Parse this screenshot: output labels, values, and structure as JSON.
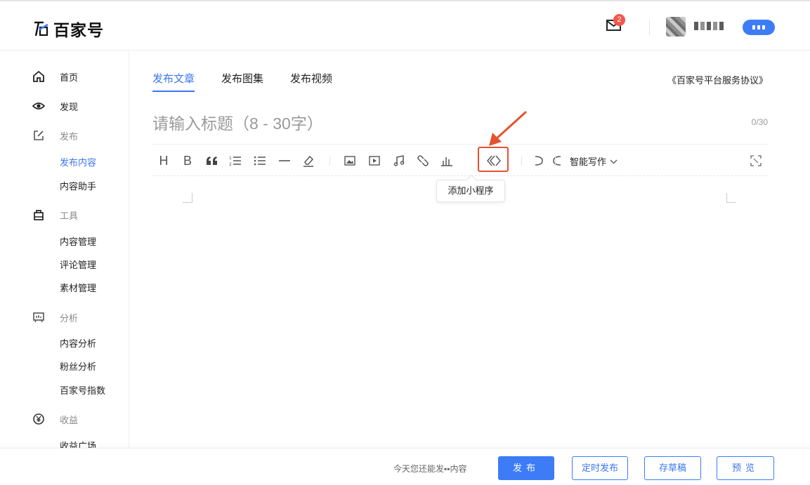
{
  "header": {
    "logo_text": "百家号",
    "mail_badge": "2"
  },
  "sidebar": {
    "items": [
      {
        "label": "首页",
        "kind": "top",
        "icon": "home-icon"
      },
      {
        "label": "发现",
        "kind": "top",
        "icon": "eye-icon"
      },
      {
        "label": "发布",
        "kind": "section",
        "icon": "edit-icon"
      },
      {
        "label": "发布内容",
        "kind": "sub-active"
      },
      {
        "label": "内容助手",
        "kind": "sub"
      },
      {
        "label": "工具",
        "kind": "section",
        "icon": "bag-icon"
      },
      {
        "label": "内容管理",
        "kind": "sub"
      },
      {
        "label": "评论管理",
        "kind": "sub"
      },
      {
        "label": "素材管理",
        "kind": "sub"
      },
      {
        "label": "分析",
        "kind": "section",
        "icon": "board-icon"
      },
      {
        "label": "内容分析",
        "kind": "sub"
      },
      {
        "label": "粉丝分析",
        "kind": "sub"
      },
      {
        "label": "百家号指数",
        "kind": "sub"
      },
      {
        "label": "收益",
        "kind": "section",
        "icon": "yuan-icon"
      },
      {
        "label": "收益广场",
        "kind": "sub"
      }
    ]
  },
  "tabs": [
    {
      "label": "发布文章",
      "active": true
    },
    {
      "label": "发布图集",
      "active": false
    },
    {
      "label": "发布视频",
      "active": false
    }
  ],
  "agreement_link": "《百家号平台服务协议》",
  "title_placeholder": "请输入标题（8 - 30字）",
  "title_counter": "0/30",
  "toolbar": {
    "smart_write_label": "智能写作",
    "tooltip": "添加小程序"
  },
  "footer": {
    "quota_text": "今天您还能发▪▪内容",
    "publish_label": "发布",
    "schedule_label": "定时发布",
    "draft_label": "存草稿",
    "preview_label": "预览"
  },
  "colors": {
    "accent": "#3d7cf6",
    "highlight_box": "#e4532f",
    "badge": "#f2574b"
  }
}
